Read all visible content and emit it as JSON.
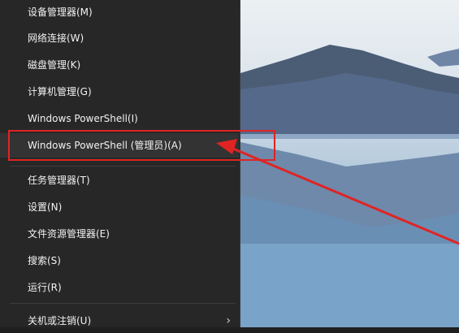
{
  "menu": {
    "items": [
      {
        "label": "设备管理器(M)"
      },
      {
        "label": "网络连接(W)"
      },
      {
        "label": "磁盘管理(K)"
      },
      {
        "label": "计算机管理(G)"
      },
      {
        "label": "Windows PowerShell(I)"
      },
      {
        "label": "Windows PowerShell (管理员)(A)"
      },
      {
        "label": "任务管理器(T)"
      },
      {
        "label": "设置(N)"
      },
      {
        "label": "文件资源管理器(E)"
      },
      {
        "label": "搜索(S)"
      },
      {
        "label": "运行(R)"
      },
      {
        "label": "关机或注销(U)"
      }
    ],
    "submenu_arrow": "›"
  },
  "colors": {
    "menu_bg": "#272727",
    "menu_text": "#f2f2f2",
    "annotation": "#e02424"
  },
  "icons": {
    "submenu": "chevron-right-icon",
    "annotation_arrow": "red-arrow-icon"
  }
}
